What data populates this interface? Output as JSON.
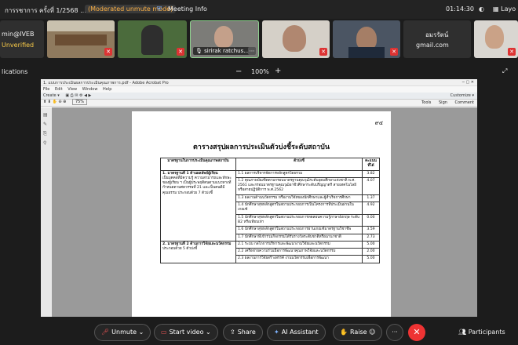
{
  "topbar": {
    "title": "การรชาการ ครั้งที่ 1/2568 ...",
    "moderated": "(Moderated unmute mode)",
    "meeting_info": "Meeting Info",
    "time": "01:14:30",
    "layout": "Layo"
  },
  "participants": [
    {
      "line1": "min@IVEB",
      "line2": "Unverified"
    },
    {
      "name": ""
    },
    {
      "name": ""
    },
    {
      "name": "sirirak ratchus..."
    },
    {
      "name": ""
    },
    {
      "name": ""
    },
    {
      "line1": "อมรรัตน์",
      "line2": "gmail.com"
    },
    {
      "name": ""
    }
  ],
  "bar2": {
    "left": "lications",
    "zoom": "100%",
    "minus": "−",
    "plus": "+"
  },
  "acrobat": {
    "window_title": "1. แบบการประเมินผลการประเมินคุณภาพการ.pdf - Adobe Acrobat Pro",
    "menu": [
      "File",
      "Edit",
      "View",
      "Window",
      "Help"
    ],
    "create": "Create ▾",
    "zoom": "75%",
    "customize": "Customize ▾",
    "right_tabs": [
      "Tools",
      "Sign",
      "Comment"
    ],
    "page_number": "๙๕",
    "page_title": "ตารางสรุปผลการประเมินตัวบ่งชี้ระดับสถาบัน",
    "table_headers": [
      "มาตรฐานในการประเมินคุณภาพสถาบัน",
      "ตัวบ่งชี้",
      "คะแนนที่ได้"
    ],
    "standard1": [
      "1. มาตรฐานที่ 1 ด้านผลลัพธ์ผู้เรียน",
      "เป็นบุคคลที่มีความรู้ ความสามารถและทักษะของผู้เรียน ฯ เป็นผู้ประพฤติตนตามแนวทางที่กำหนดตามศตวรรษที่ 21 และเป็นคนดีมีคุณธรรม ประกอบด้วย 7 ตัวบ่งชี้"
    ],
    "rows1": [
      {
        "i": "1.1 ผลการบริหารจัดการหลักสูตรโดยรวม",
        "v": "3.82"
      },
      {
        "i": "1.2 คุณภาพบัณฑิตตามกรอบมาตรฐานคุณวุฒิระดับอุดมศึกษาแห่งชาติ พ.ศ. 2561 และกรอบมาตรฐานคุณวุฒิอาชีวศึกษาระดับปริญญาตรี สายเทคโนโลยีหรือสายปฏิบัติการ พ.ศ.2562",
        "v": "4.07"
      },
      {
        "i": "1.3 ผลงานด้านนวัตกรรม หรืองานวิจัยของนักศึกษาและผู้สำเร็จการศึกษา",
        "v": "1.37"
      },
      {
        "i": "1.4 นักศึกษาสุขหลักสูตรในสถานประกอบการเป็นโครงการที่ประเมินผ่านในเกณฑ์",
        "v": "4.92"
      },
      {
        "i": "1.5 นักศึกษาสุขหลักสูตรในสถานประกอบการทดสอบความรู้ภาษาอังกฤษ ระดับ B2 หรือเทียบเท่า",
        "v": "0.00"
      },
      {
        "i": "1.6 นักศึกษาสุขหลักสูตรในสถานประกอบการผ่านเกณฑ์มาตรฐานวิชาชีพ",
        "v": "3.59"
      },
      {
        "i": "1.7 นักศึกษาที่เข้าร่วมกิจกรรมได้รับรางวัลระดับชาติหรือนานาชาติ",
        "v": "2.73"
      }
    ],
    "standard2": [
      "2. มาตรฐานที่ 2 ด้านการวิจัยและนวัตกรรม",
      "ประกอบด้วย 5 ตัวบ่งชี้"
    ],
    "rows2": [
      {
        "i": "2.1 ระบบ กลไกการบริหารและพัฒนางานวิจัยและนวัตกรรม",
        "v": "5.00"
      },
      {
        "i": "2.2 เครือข่ายความร่วมมือการพัฒนาคุณภาพวิจัยและนวัตกรรม",
        "v": "2.00"
      },
      {
        "i": "2.3 ผลงานการวิจัยสร้างสรรค์ งานนวัตกรรมเพื่อการพัฒนา",
        "v": "5.00"
      }
    ]
  },
  "controls": {
    "unmute": "Unmute",
    "start_video": "Start video",
    "share": "Share",
    "ai": "AI Assistant",
    "raise": "Raise",
    "more": "···",
    "leave": "✕",
    "participants": "Participants"
  }
}
